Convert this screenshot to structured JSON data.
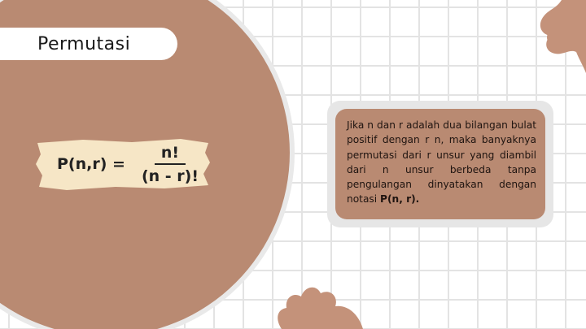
{
  "slide": {
    "title": "Permutasi",
    "formula": {
      "lhs": "P(n,r) =",
      "numerator": "n!",
      "denominator": "(n - r)!"
    },
    "description": "Jika n dan r adalah dua bilangan bulat positif dengan r   n, maka banyaknya permutasi dari r unsur yang diambil dari n unsur berbeda tanpa pengulangan dinyatakan dengan notasi ",
    "description_emphasis": "P(n, r)."
  },
  "colors": {
    "brown": "#b98a72",
    "cream": "#f6e6c6",
    "card_border": "#e6e6e6",
    "grid": "#e3e3e3"
  }
}
